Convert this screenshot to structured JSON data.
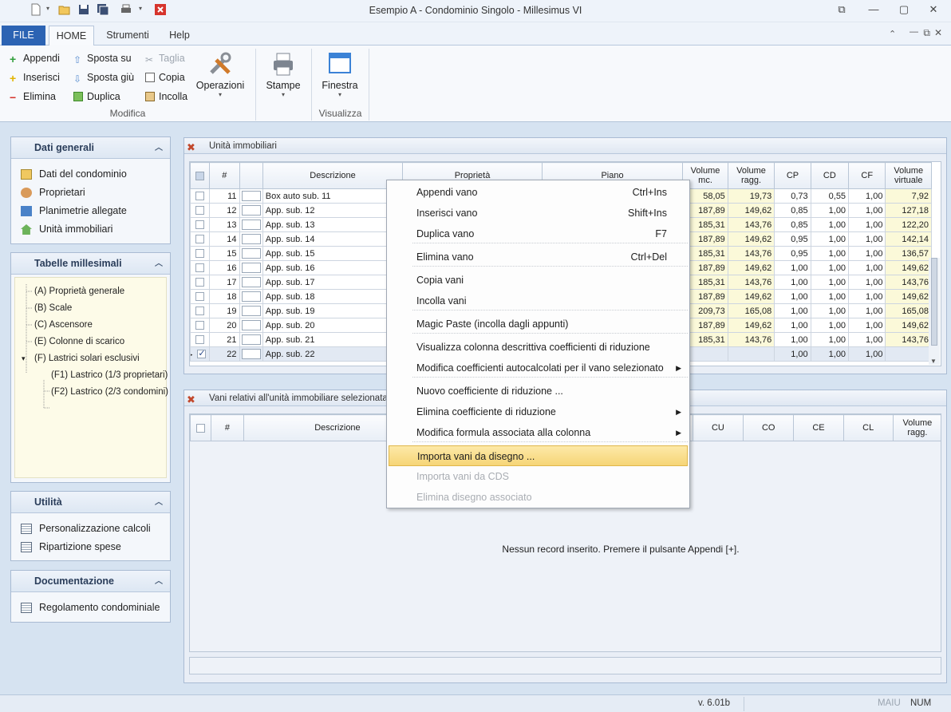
{
  "window": {
    "title": "Esempio A - Condominio Singolo - Millesimus VI"
  },
  "tabs": {
    "file": "FILE",
    "home": "HOME",
    "strumenti": "Strumenti",
    "help": "Help"
  },
  "ribbon": {
    "appendi": "Appendi",
    "inserisci": "Inserisci",
    "elimina": "Elimina",
    "sposta_su": "Sposta su",
    "sposta_giu": "Sposta giù",
    "duplica": "Duplica",
    "taglia": "Taglia",
    "copia": "Copia",
    "incolla": "Incolla",
    "operazioni": "Operazioni",
    "stampe": "Stampe",
    "finestra": "Finestra",
    "group_modifica": "Modifica",
    "group_visualizza": "Visualizza"
  },
  "sidebar": {
    "dati_generali": {
      "title": "Dati generali",
      "items": [
        "Dati del condominio",
        "Proprietari",
        "Planimetrie allegate",
        "Unità immobiliari"
      ]
    },
    "tabelle": {
      "title": "Tabelle millesimali",
      "items": [
        "(A) Proprietà generale",
        "(B) Scale",
        "(C) Ascensore",
        "(E) Colonne di scarico",
        "(F) Lastrici solari esclusivi",
        "(F1) Lastrico (1/3 proprietari)",
        "(F2) Lastrico (2/3 condomini)"
      ]
    },
    "utilita": {
      "title": "Utilità",
      "items": [
        "Personalizzazione calcoli",
        "Ripartizione spese"
      ]
    },
    "documentazione": {
      "title": "Documentazione",
      "items": [
        "Regolamento condominiale"
      ]
    }
  },
  "units_panel": {
    "title": "Unità immobiliari",
    "headers": {
      "hash": "#",
      "descrizione": "Descrizione",
      "proprieta": "Proprietà",
      "piano": "Piano",
      "vol_mc_1": "Volume",
      "vol_mc_2": "mc.",
      "vol_ragg_1": "Volume",
      "vol_ragg_2": "ragg.",
      "cp": "CP",
      "cd": "CD",
      "cf": "CF",
      "vol_virt_1": "Volume",
      "vol_virt_2": "virtuale"
    },
    "rows": [
      {
        "n": "11",
        "desc": "Box auto sub. 11",
        "vmc": "58,05",
        "vragg": "19,73",
        "cp": "0,73",
        "cd": "0,55",
        "cf": "1,00",
        "vvirt": "7,92"
      },
      {
        "n": "12",
        "desc": "App. sub. 12",
        "vmc": "187,89",
        "vragg": "149,62",
        "cp": "0,85",
        "cd": "1,00",
        "cf": "1,00",
        "vvirt": "127,18"
      },
      {
        "n": "13",
        "desc": "App. sub. 13",
        "vmc": "185,31",
        "vragg": "143,76",
        "cp": "0,85",
        "cd": "1,00",
        "cf": "1,00",
        "vvirt": "122,20"
      },
      {
        "n": "14",
        "desc": "App. sub. 14",
        "vmc": "187,89",
        "vragg": "149,62",
        "cp": "0,95",
        "cd": "1,00",
        "cf": "1,00",
        "vvirt": "142,14"
      },
      {
        "n": "15",
        "desc": "App. sub. 15",
        "vmc": "185,31",
        "vragg": "143,76",
        "cp": "0,95",
        "cd": "1,00",
        "cf": "1,00",
        "vvirt": "136,57"
      },
      {
        "n": "16",
        "desc": "App. sub. 16",
        "vmc": "187,89",
        "vragg": "149,62",
        "cp": "1,00",
        "cd": "1,00",
        "cf": "1,00",
        "vvirt": "149,62"
      },
      {
        "n": "17",
        "desc": "App. sub. 17",
        "vmc": "185,31",
        "vragg": "143,76",
        "cp": "1,00",
        "cd": "1,00",
        "cf": "1,00",
        "vvirt": "143,76"
      },
      {
        "n": "18",
        "desc": "App. sub. 18",
        "vmc": "187,89",
        "vragg": "149,62",
        "cp": "1,00",
        "cd": "1,00",
        "cf": "1,00",
        "vvirt": "149,62"
      },
      {
        "n": "19",
        "desc": "App. sub. 19",
        "vmc": "209,73",
        "vragg": "165,08",
        "cp": "1,00",
        "cd": "1,00",
        "cf": "1,00",
        "vvirt": "165,08"
      },
      {
        "n": "20",
        "desc": "App. sub. 20",
        "vmc": "187,89",
        "vragg": "149,62",
        "cp": "1,00",
        "cd": "1,00",
        "cf": "1,00",
        "vvirt": "149,62"
      },
      {
        "n": "21",
        "desc": "App. sub. 21",
        "vmc": "185,31",
        "vragg": "143,76",
        "cp": "1,00",
        "cd": "1,00",
        "cf": "1,00",
        "vvirt": "143,76"
      },
      {
        "n": "22",
        "desc": "App. sub. 22",
        "vmc": "",
        "vragg": "",
        "cp": "1,00",
        "cd": "1,00",
        "cf": "1,00",
        "vvirt": ""
      }
    ]
  },
  "vani_panel": {
    "title": "Vani relativi all'unità immobiliare selezionata",
    "headers": {
      "hash": "#",
      "descrizione": "Descrizione",
      "cu": "CU",
      "co": "CO",
      "ce": "CE",
      "cl": "CL",
      "vol_ragg_1": "Volume",
      "vol_ragg_2": "ragg."
    },
    "empty": "Nessun record inserito. Premere il pulsante Appendi [+]."
  },
  "context_menu": {
    "items": [
      {
        "label": "Appendi vano",
        "shortcut": "Ctrl+Ins"
      },
      {
        "label": "Inserisci vano",
        "shortcut": "Shift+Ins"
      },
      {
        "label": "Duplica vano",
        "shortcut": "F7"
      },
      {
        "label": "Elimina vano",
        "shortcut": "Ctrl+Del"
      },
      {
        "label": "Copia vani",
        "shortcut": ""
      },
      {
        "label": "Incolla vani",
        "shortcut": ""
      },
      {
        "label": "Magic Paste (incolla dagli appunti)",
        "shortcut": ""
      },
      {
        "label": "Visualizza colonna descrittiva coefficienti di riduzione",
        "shortcut": ""
      },
      {
        "label": "Modifica coefficienti autocalcolati per il vano selezionato",
        "shortcut": ""
      },
      {
        "label": "Nuovo coefficiente di riduzione ...",
        "shortcut": ""
      },
      {
        "label": "Elimina coefficiente di riduzione",
        "shortcut": ""
      },
      {
        "label": "Modifica formula associata alla colonna",
        "shortcut": ""
      },
      {
        "label": "Importa vani da disegno ...",
        "shortcut": ""
      },
      {
        "label": "Importa vani da CDS",
        "shortcut": ""
      },
      {
        "label": "Elimina disegno associato",
        "shortcut": ""
      }
    ]
  },
  "status": {
    "version": "v. 6.01b",
    "maiu": "MAIU",
    "num": "NUM"
  },
  "colors": {
    "accent": "#2c63b3",
    "highlight": "#f6d577",
    "grid_yellow": "#fbf9d9"
  }
}
